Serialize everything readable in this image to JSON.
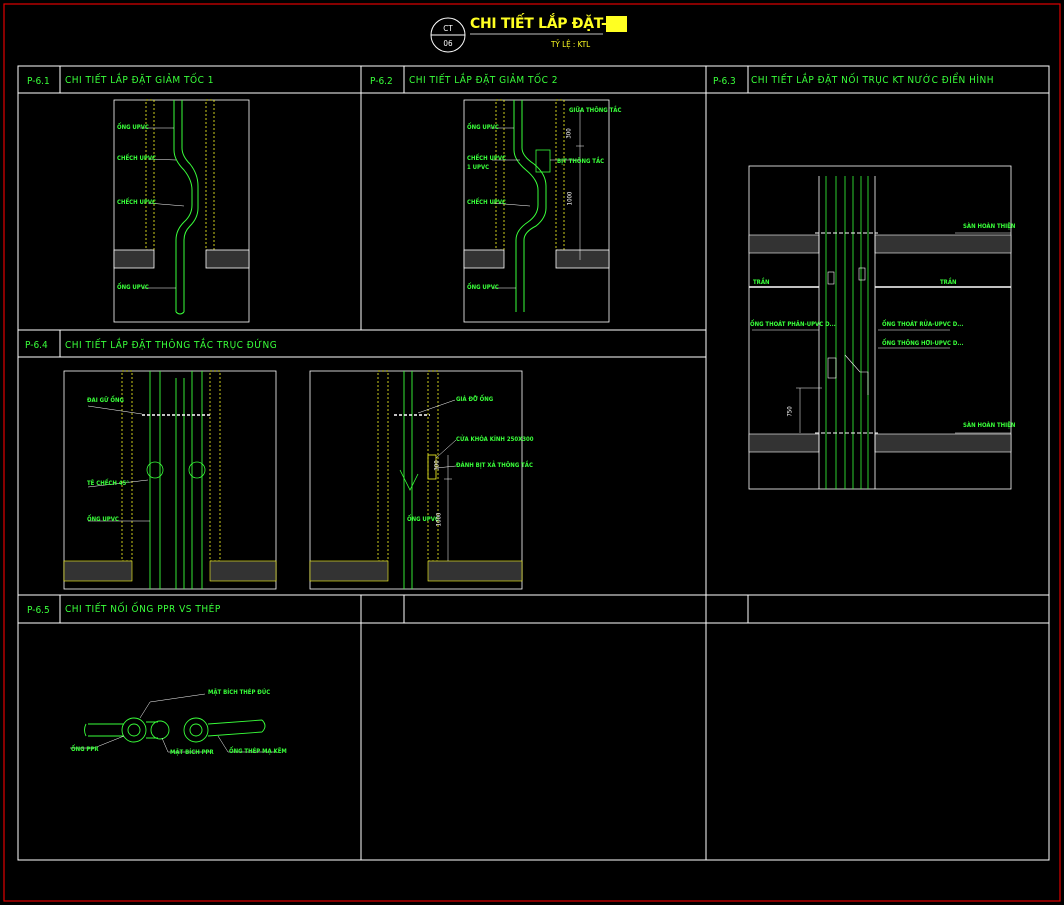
{
  "sheet": {
    "title_main": "CHI TIẾT LẮP ĐẶT-",
    "title_hl": "06",
    "scale": "TỶ LỆ : KTL",
    "ct_top": "CT",
    "ct_bottom": "06"
  },
  "cells": [
    {
      "code": "P-6.1",
      "title": "CHI TIẾT  LẮP ĐẶT GIẢM TỐC 1"
    },
    {
      "code": "P-6.2",
      "title": "CHI TIẾT  LẮP ĐẶT GIẢM TỐC 2"
    },
    {
      "code": "P-6.3",
      "title": "CHI TIẾT  LẮP ĐẶT NỐI TRỤC KT NƯỚC ĐIỂN HÌNH"
    },
    {
      "code": "P-6.4",
      "title": "CHI TIẾT  LẮP ĐẶT THÔNG TẮC TRỤC ĐỨNG"
    },
    {
      "code": "P-6.5",
      "title": "CHI TIẾT  NỐI ỐNG PPR VS  THÉP"
    }
  ],
  "annotations": {
    "d61": {
      "a": "ỐNG UPVC",
      "b": "CHẾCH UPVC",
      "c": "CHẾCH UPVC",
      "d": "ỐNG UPVC"
    },
    "d62": {
      "a": "ỐNG UPVC",
      "b": "CHẾCH UPVC",
      "b2": "1 UPVC",
      "c": "CHẾCH UPVC",
      "d": "ỐNG UPVC",
      "e": "GIỮA THÔNG TẮC",
      "f": "BỊT THÔNG TẮC",
      "dim1": "300",
      "dim2": "1000"
    },
    "d63": {
      "a": "SÀN HOÀN THIỆN",
      "b": "TRẦN",
      "c": "TRẦN",
      "d": "ỐNG THOÁT PHÂN-UPVC D...",
      "e": "ỐNG THOÁT RỬA-UPVC D...",
      "f": "ỐNG THÔNG HƠI-UPVC D...",
      "g": "SÀN HOÀN THIỆN",
      "dim": "750"
    },
    "d64a": {
      "a": "ĐAI GỮ ỐNG",
      "b": "TÊ CHẾCH 45°",
      "c": "ỐNG UPVC"
    },
    "d64b": {
      "a": "GIÁ ĐỠ ỐNG",
      "b": "CỬA KHÓA KÍNH 250X300",
      "c": "ĐÁNH BỊT XẢ THÔNG TẮC",
      "d": "ỐNG UPVC",
      "dim1": "300",
      "dim2": "1000"
    },
    "d65": {
      "a": "MẶT BÍCH THÉP ĐÚC",
      "b": "ỐNG PPR",
      "c": "MẶT BÍCH PPR",
      "d": "ỐNG THÉP MẠ KẼM"
    }
  }
}
